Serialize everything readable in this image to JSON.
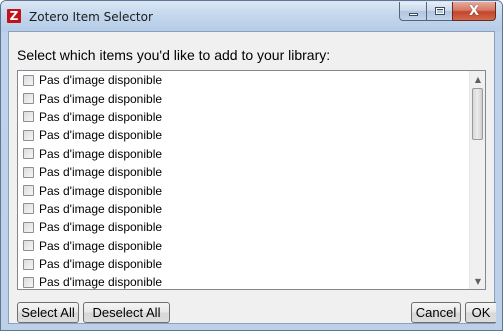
{
  "window": {
    "title": "Zotero Item Selector",
    "app_icon_letter": "Z",
    "controls": {
      "minimize_icon": "minimize-icon",
      "maximize_icon": "maximize-icon",
      "close_icon": "close-icon",
      "close_glyph": "X"
    }
  },
  "dialog": {
    "prompt": "Select which items you'd like to add to your library:",
    "items": [
      {
        "label": "Pas d'image disponible",
        "checked": false
      },
      {
        "label": "Pas d'image disponible",
        "checked": false
      },
      {
        "label": "Pas d'image disponible",
        "checked": false
      },
      {
        "label": "Pas d'image disponible",
        "checked": false
      },
      {
        "label": "Pas d'image disponible",
        "checked": false
      },
      {
        "label": "Pas d'image disponible",
        "checked": false
      },
      {
        "label": "Pas d'image disponible",
        "checked": false
      },
      {
        "label": "Pas d'image disponible",
        "checked": false
      },
      {
        "label": "Pas d'image disponible",
        "checked": false
      },
      {
        "label": "Pas d'image disponible",
        "checked": false
      },
      {
        "label": "Pas d'image disponible",
        "checked": false
      },
      {
        "label": "Pas d'image disponible",
        "checked": false
      }
    ],
    "buttons": {
      "select_all": "Select All",
      "deselect_all": "Deselect All",
      "cancel": "Cancel",
      "ok": "OK"
    }
  },
  "colors": {
    "app_icon": "#c2121a",
    "close_button": "#c2452b",
    "frame": "#bcd0e8"
  }
}
